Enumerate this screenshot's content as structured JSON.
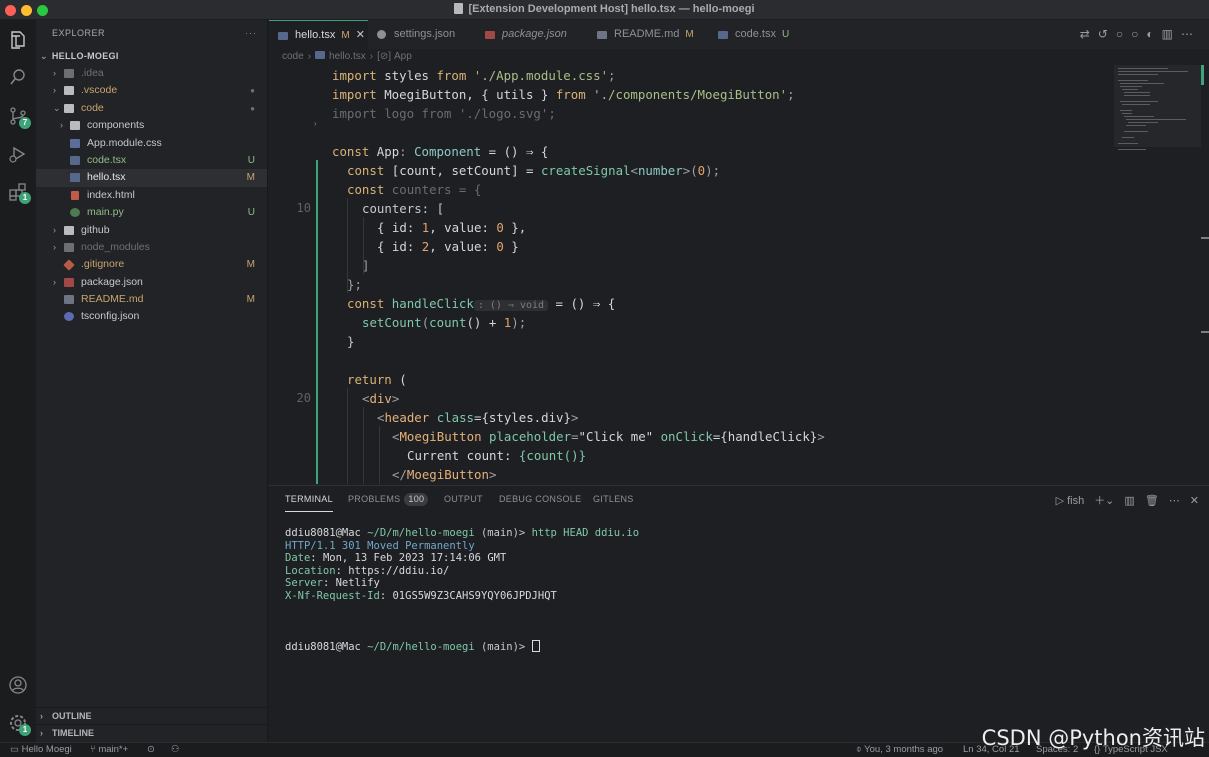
{
  "window": {
    "title": "[Extension Development Host] hello.tsx — hello-moegi"
  },
  "activity": {
    "items": [
      "explorer",
      "search",
      "source-control",
      "run-debug",
      "extensions",
      "account",
      "manage"
    ],
    "source_control_badge": "7",
    "extensions_badge": "1",
    "manage_badge": "1"
  },
  "sidebar": {
    "header": "EXPLORER",
    "more": "···",
    "folder": "HELLO-MOEGI",
    "tree": [
      {
        "name": ".idea",
        "badge": ""
      },
      {
        "name": ".vscode",
        "badge": "●"
      },
      {
        "name": "code",
        "badge": "●"
      },
      {
        "name": "components",
        "badge": ""
      },
      {
        "name": "App.module.css",
        "badge": ""
      },
      {
        "name": "code.tsx",
        "badge": "U"
      },
      {
        "name": "hello.tsx",
        "badge": "M"
      },
      {
        "name": "index.html",
        "badge": ""
      },
      {
        "name": "main.py",
        "badge": "U"
      },
      {
        "name": "github",
        "badge": ""
      },
      {
        "name": "node_modules",
        "badge": ""
      },
      {
        "name": ".gitignore",
        "badge": "M"
      },
      {
        "name": "package.json",
        "badge": ""
      },
      {
        "name": "README.md",
        "badge": "M"
      },
      {
        "name": "tsconfig.json",
        "badge": ""
      }
    ],
    "outline": "OUTLINE",
    "timeline": "TIMELINE"
  },
  "tabs": [
    {
      "label": "hello.tsx",
      "status": "M"
    },
    {
      "label": "settings.json",
      "status": ""
    },
    {
      "label": "package.json",
      "status": ""
    },
    {
      "label": "README.md",
      "status": "M"
    },
    {
      "label": "code.tsx",
      "status": "U"
    }
  ],
  "breadcrumb": [
    "code",
    "hello.tsx",
    "App"
  ],
  "breadcrumb_symbol": "[⊘]",
  "code": {
    "line_numbers": {
      "ln10": "10",
      "ln20": "20"
    },
    "l1": [
      "import",
      " styles ",
      "from",
      " ",
      "'./App.module.css'",
      ";"
    ],
    "l2": [
      "import",
      " MoegiButton, { utils } ",
      "from",
      " ",
      "'./components/MoegiButton'",
      ";"
    ],
    "l3": "import logo from './logo.svg';",
    "l5": [
      "const",
      " App",
      ": ",
      "Component",
      " = () ⇒ {"
    ],
    "l6": [
      "const",
      " [count, setCount] = ",
      "createSignal",
      "<",
      "number",
      ">(",
      "0",
      ");"
    ],
    "l7": [
      "const",
      " counters = {"
    ],
    "l8": "counters: [",
    "l9": [
      "{ id: ",
      "1",
      ", value: ",
      "0",
      " },"
    ],
    "l10": [
      "{ id: ",
      "2",
      ", value: ",
      "0",
      " }"
    ],
    "l11": "]",
    "l12": "};",
    "l13": [
      "const",
      " handleClick",
      ": () ⇒ void",
      " = () ⇒ {"
    ],
    "l14": [
      "setCount",
      "(",
      "count",
      "() + ",
      "1",
      ");"
    ],
    "l15": "}",
    "l17": [
      "return",
      " ("
    ],
    "l18": [
      "<",
      "div",
      ">"
    ],
    "l19": [
      "<",
      "header",
      " class",
      "={styles.div}",
      ">"
    ],
    "l20": [
      "<",
      "MoegiButton",
      " placeholder",
      "=",
      "\"Click me\"",
      " onClick",
      "={handleClick}",
      ">"
    ],
    "l21": [
      "Current count: ",
      "{count()}"
    ],
    "l22": [
      "</",
      "MoegiButton",
      ">"
    ]
  },
  "panel": {
    "tabs": [
      "TERMINAL",
      "PROBLEMS",
      "OUTPUT",
      "DEBUG CONSOLE",
      "GITLENS"
    ],
    "problems_count": "100",
    "shell": "fish"
  },
  "terminal": {
    "prompt_user": "ddiu8081@Mac",
    "prompt_path": "~/D/m/hello-moegi",
    "prompt_branch": "(main)>",
    "command": "http HEAD ddiu.io",
    "status": "HTTP/1.1 301 Moved Permanently",
    "headers": [
      {
        "key": "Date",
        "value": "Mon, 13 Feb 2023 17:14:06 GMT"
      },
      {
        "key": "Location",
        "value": "https://ddiu.io/"
      },
      {
        "key": "Server",
        "value": "Netlify"
      },
      {
        "key": "X-Nf-Request-Id",
        "value": "01GS5W9Z3CAHS9YQY06JPDJHQT"
      }
    ]
  },
  "statusbar": {
    "remote": "Hello Moegi",
    "branch": "main*+",
    "blame": "You, 3 months ago",
    "position": "Ln 34, Col 21",
    "spaces": "Spaces: 2",
    "language": "TypeScript JSX"
  },
  "watermark": "CSDN @Python资讯站",
  "colors": {
    "accent": "#3fa37a",
    "modified": "#c9a46f",
    "untracked": "#8fbf88",
    "keyword": "#d9b277",
    "string": "#a8bf88"
  }
}
